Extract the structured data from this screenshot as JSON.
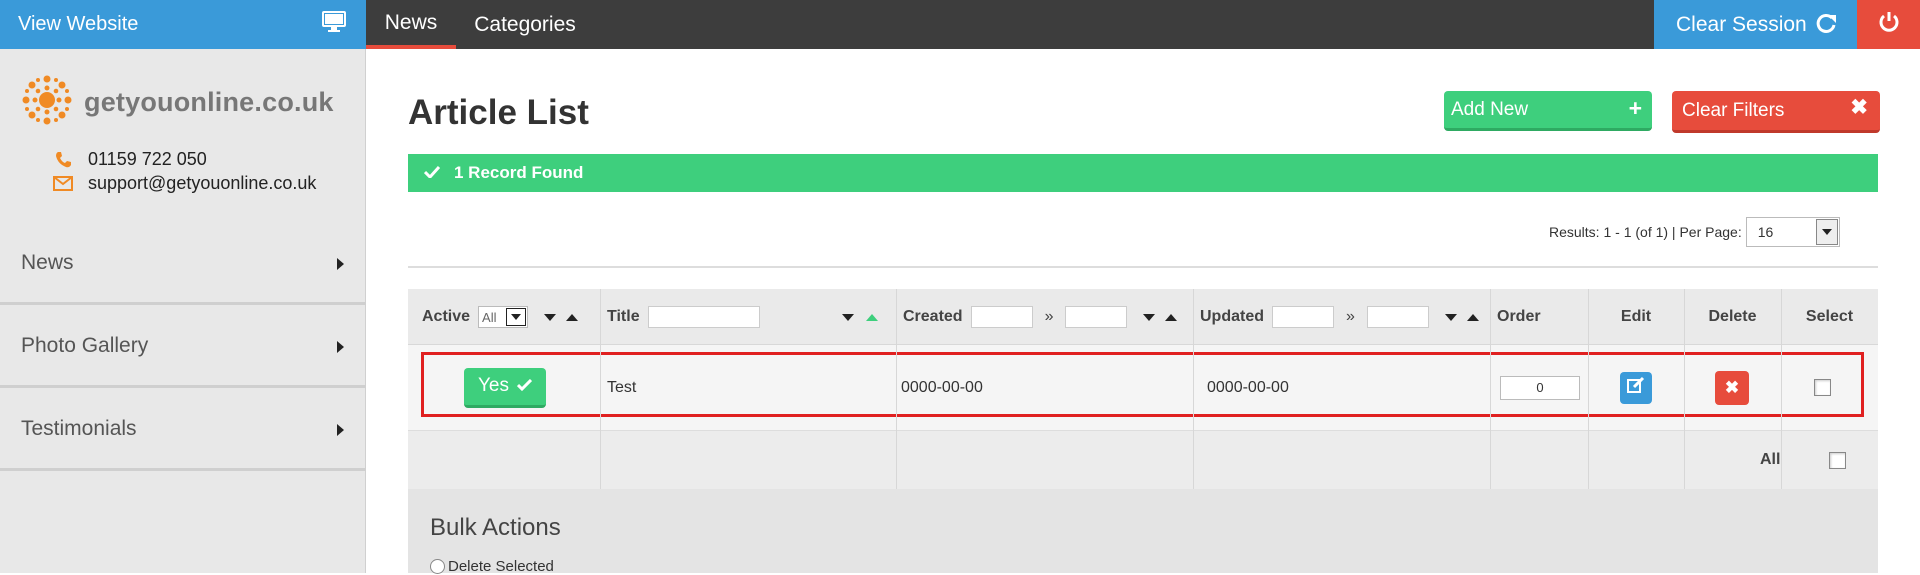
{
  "topbar": {
    "view_website": "View Website",
    "tabs": [
      "News",
      "Categories"
    ],
    "clear_session": "Clear Session"
  },
  "sidebar": {
    "logo_text": "getyouonline.co.uk",
    "phone": "01159 722 050",
    "email": "support@getyouonline.co.uk",
    "items": [
      {
        "label": "News"
      },
      {
        "label": "Photo Gallery"
      },
      {
        "label": "Testimonials"
      }
    ]
  },
  "main": {
    "title": "Article List",
    "add_new": "Add New",
    "clear_filters": "Clear Filters",
    "records_found": "1 Record Found",
    "results_text": "Results: 1 - 1 (of 1) | Per Page:",
    "per_page": "16"
  },
  "table": {
    "headers": {
      "active": "Active",
      "active_filter": "All",
      "title": "Title",
      "created": "Created",
      "updated": "Updated",
      "range_sep": "»",
      "order": "Order",
      "edit": "Edit",
      "delete": "Delete",
      "select": "Select"
    },
    "rows": [
      {
        "active": "Yes",
        "title": "Test",
        "created": "0000-00-00",
        "updated": "0000-00-00",
        "order": "0"
      }
    ],
    "select_all": "All"
  },
  "bulk": {
    "title": "Bulk Actions",
    "delete_selected": "Delete Selected"
  },
  "colors": {
    "blue": "#3a9ad9",
    "green": "#3ecf7d",
    "red": "#e74c3c",
    "dark": "#3d3d3d",
    "orange": "#f08a24"
  }
}
